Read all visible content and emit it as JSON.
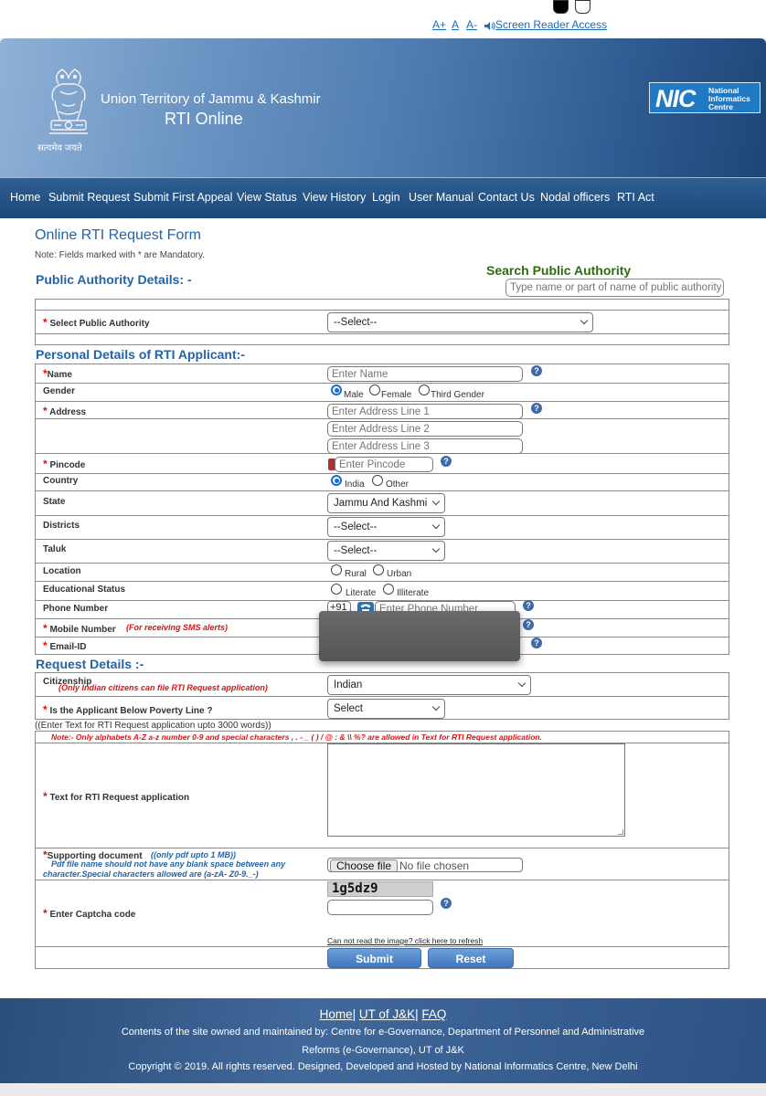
{
  "accessibility": {
    "font_increase": "A+",
    "font_normal": "A",
    "font_decrease": "A-",
    "screen_reader": "Screen Reader Access"
  },
  "header": {
    "emblem_motto": "सत्यमेव जयते",
    "ut_name": "Union Territory of Jammu & Kashmir",
    "portal_title": "RTI Online",
    "nic_logo": {
      "abbr": "NIC",
      "text": "National Informatics Centre"
    }
  },
  "nav": [
    "Home",
    "Submit Request",
    "Submit First Appeal",
    "View Status",
    "View History",
    "Login",
    "User Manual",
    "Contact Us",
    "Nodal officers",
    "RTI Act"
  ],
  "form": {
    "title": "Online RTI Request Form",
    "mandatory_note": "Note: Fields marked with * are Mandatory.",
    "section_public_authority": "Public Authority Details: -",
    "search_label": "Search Public Authority",
    "search_placeholder": "Type name or part of name of public authority",
    "select_public_authority_label": "Select Public Authority",
    "select_public_authority_value": "--Select--",
    "section_personal": "Personal Details of RTI Applicant:-",
    "name_label": "Name",
    "name_placeholder": "Enter Name",
    "gender_label": "Gender",
    "gender_options": [
      "Male",
      "Female",
      "Third Gender"
    ],
    "address_label": "Address",
    "address_placeholders": [
      "Enter Address Line 1",
      "Enter Address Line 2",
      "Enter Address Line 3"
    ],
    "pincode_label": "Pincode",
    "pincode_placeholder": "Enter Pincode",
    "country_label": "Country",
    "country_options": [
      "India",
      "Other"
    ],
    "state_label": "State",
    "state_value": "Jammu And Kashmi",
    "districts_label": "Districts",
    "districts_value": "--Select--",
    "taluk_label": "Taluk",
    "taluk_value": "--Select--",
    "location_label": "Location",
    "location_options": [
      "Rural",
      "Urban"
    ],
    "education_label": "Educational Status",
    "education_options": [
      "Literate",
      "Illiterate"
    ],
    "phone_label": "Phone Number",
    "phone_code": "+91",
    "phone_placeholder": "Enter Phone Number",
    "mobile_label": "Mobile Number",
    "mobile_note": "(For receiving SMS alerts)",
    "email_label": "Email-ID",
    "section_request": "Request Details :-",
    "citizenship_label": "Citizenship",
    "citizenship_note": "(Only Indian citizens can file RTI Request application)",
    "citizenship_value": "Indian",
    "bpl_label": "Is the Applicant Below Poverty Line ?",
    "bpl_value": "Select",
    "text_limit_note": "((Enter Text for RTI Request application upto 3000 words))",
    "text_chars_note": "Note:- Only alphabets A-Z a-z number 0-9 and special characters , . - _ ( ) / @ : & \\\\ %? are allowed in Text for RTI Request application.",
    "text_label": "Text for RTI Request application",
    "supporting_label": "Supporting document",
    "supporting_note": "((only pdf upto 1 MB))",
    "supporting_hint": "Pdf file name should not have any blank space between any character.Special characters allowed are (a-zA- Z0-9._-)",
    "choose_file": "Choose file",
    "no_file": "No file chosen",
    "captcha_label": "Enter Captcha code",
    "captcha_text": "1g5dz9",
    "captcha_refresh": "Can not read the image? click here to refresh",
    "submit": "Submit",
    "reset": "Reset"
  },
  "footer": {
    "links": [
      "Home",
      "UT of J&K",
      "FAQ"
    ],
    "line1": "Contents of the site owned and maintained by: Centre for e-Governance, Department of Personnel and Administrative",
    "line2": "Reforms (e-Governance), UT of J&K",
    "copyright": "Copyright © 2019. All rights reserved. Designed, Developed and Hosted by National Informatics Centre, New Delhi"
  },
  "colors": {
    "header_blue": "#4d79ad",
    "nav_blue": "#1c4878",
    "section_blue": "#2464a4",
    "search_green": "#2e6b12",
    "mandatory_red": "#dd1111"
  }
}
